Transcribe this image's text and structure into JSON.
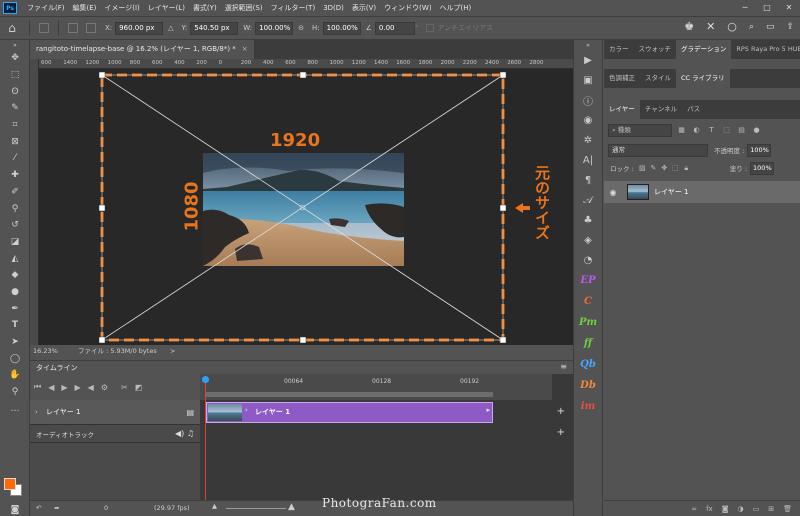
{
  "menu": {
    "logo": "Ps",
    "items": [
      "ファイル(F)",
      "編集(E)",
      "イメージ(I)",
      "レイヤー(L)",
      "書式(Y)",
      "選択範囲(S)",
      "フィルター(T)",
      "3D(D)",
      "表示(V)",
      "ウィンドウ(W)",
      "ヘルプ(H)"
    ]
  },
  "options": {
    "x_label": "X:",
    "x_value": "960.00 px",
    "y_label": "Y:",
    "y_value": "540.50 px",
    "w_label": "W:",
    "w_value": "100.00%",
    "h_label": "H:",
    "h_value": "100.00%",
    "angle_value": "0.00",
    "angle_unit": "°",
    "antialias_label": "アンチエイリアス"
  },
  "document": {
    "tab_title": "rangitoto-timelapse-base @ 16.2% (レイヤー 1, RGB/8*) *",
    "tab_close": "×",
    "ruler_ticks": [
      "600",
      "1400",
      "1200",
      "1000",
      "800",
      "600",
      "400",
      "200",
      "0",
      "200",
      "400",
      "600",
      "800",
      "1000",
      "1200",
      "1400",
      "1600",
      "1800",
      "2000",
      "2200",
      "2400",
      "2600",
      "2800"
    ],
    "zoom": "16.23%",
    "file_info": "ファイル : 5.93M/0 bytes",
    "status_arrow": ">"
  },
  "annotations": {
    "width_label": "1920",
    "height_label": "1080",
    "original_size": "元のサイズ",
    "color": "#e8741c"
  },
  "timeline": {
    "panel_title": "タイムライン",
    "ruler_labels": [
      "00064",
      "00128",
      "00192"
    ],
    "layer_track": "レイヤー 1",
    "clip_label": "レイヤー 1",
    "audio_track": "オーディオトラック",
    "footer_frame": "0",
    "footer_fps": "(29.97 fps)",
    "playhead_color": "#2ea0ff",
    "clip_color": "#8e5ac5"
  },
  "right_panels": {
    "top_tabs": [
      "カラー",
      "スウォッチ",
      "グラデーション",
      "RPS Raya Pro 5 HUE"
    ],
    "active_top_tab": "グラデーション",
    "sub_tabs": [
      "色調補正",
      "スタイル",
      "CC ライブラリ"
    ],
    "layer_tabs": [
      "レイヤー",
      "チャンネル",
      "パス"
    ],
    "search_placeholder": "種類",
    "blend_mode": "通常",
    "opacity_label": "不透明度 :",
    "opacity_value": "100%",
    "lock_label": "ロック :",
    "fill_label": "塗り :",
    "fill_value": "100%",
    "layer_name": "レイヤー 1",
    "footer_icons": [
      "link-icon",
      "fx-icon",
      "mask-icon",
      "adjustment-icon",
      "group-icon",
      "new-layer-icon",
      "trash-icon"
    ]
  },
  "plugins": [
    {
      "label": "EP",
      "color": "#b45cf2"
    },
    {
      "label": "C",
      "color": "#ef6b3a"
    },
    {
      "label": "Pm",
      "color": "#6ccf3d"
    },
    {
      "label": "ff",
      "color": "#6ccf3d"
    },
    {
      "label": "Qb",
      "color": "#4aa3ff"
    },
    {
      "label": "Db",
      "color": "#ef8a3a"
    },
    {
      "label": "im",
      "color": "#e8513a"
    }
  ],
  "watermark": "PhotograFan.com"
}
